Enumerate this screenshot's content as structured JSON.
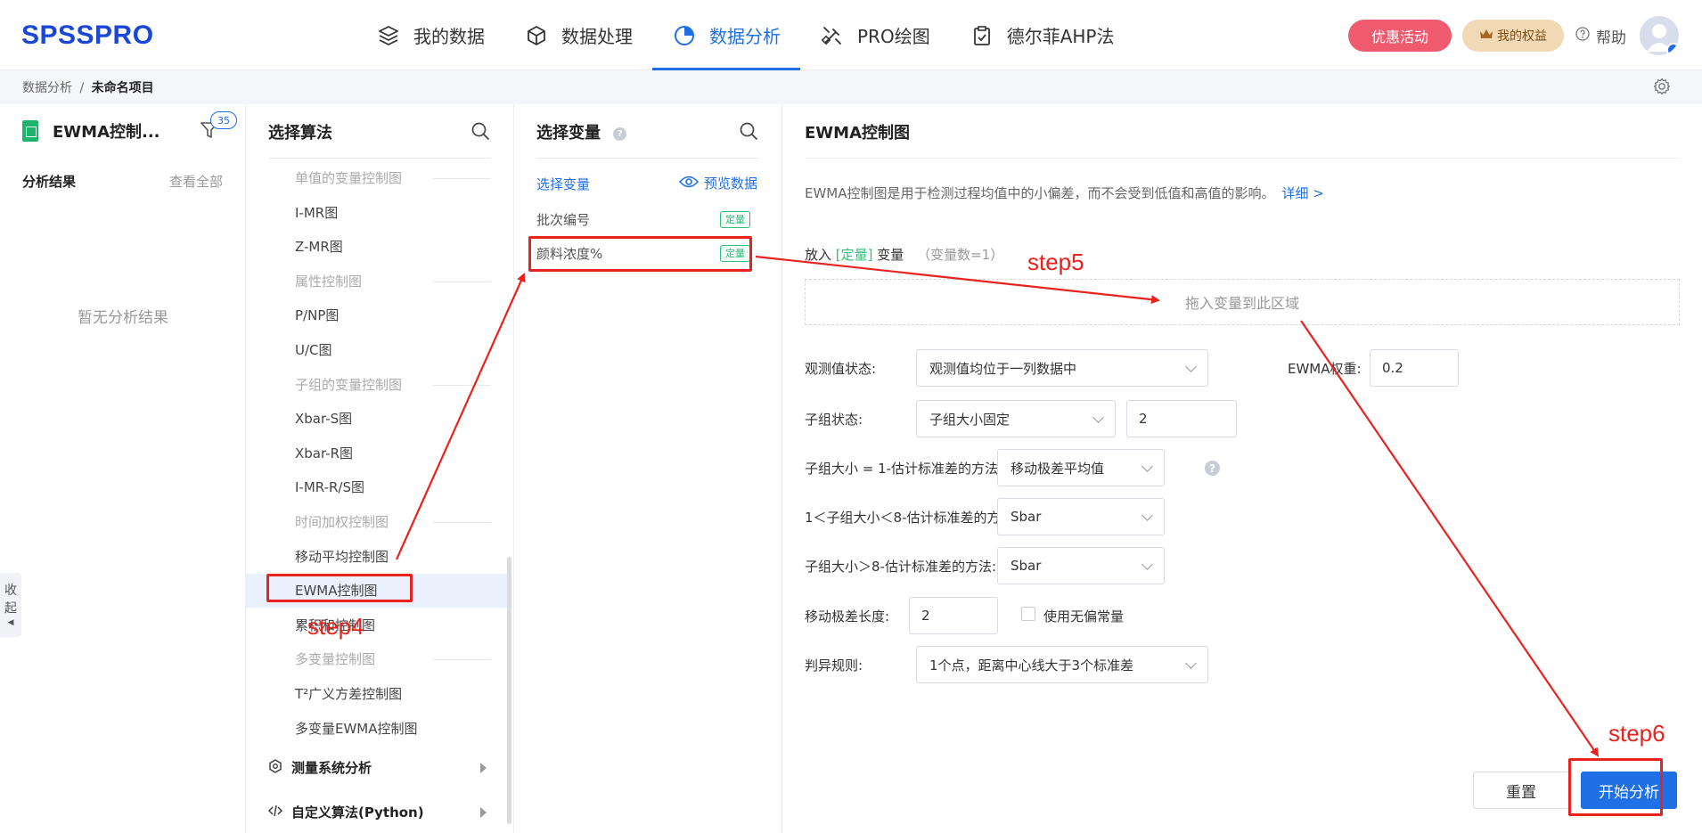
{
  "header": {
    "logo": "SPSSPRO",
    "nav": [
      {
        "label": "我的数据",
        "icon": "layers-icon"
      },
      {
        "label": "数据处理",
        "icon": "cube-icon"
      },
      {
        "label": "数据分析",
        "icon": "pie-chart-icon",
        "active": true
      },
      {
        "label": "PRO绘图",
        "icon": "brush-icon"
      },
      {
        "label": "德尔菲AHP法",
        "icon": "clipboard-icon"
      }
    ],
    "promo_label": "优惠活动",
    "rights_label": "我的权益",
    "help_label": "帮助"
  },
  "breadcrumb": {
    "root": "数据分析",
    "separator": "/",
    "current": "未命名项目"
  },
  "left_panel": {
    "title": "EWMA控制...",
    "filter_count": "35",
    "results_label": "分析结果",
    "view_all_label": "查看全部",
    "empty_text": "暂无分析结果",
    "collapse_label": [
      "收",
      "起"
    ]
  },
  "algo_panel": {
    "title": "选择算法",
    "entries": [
      {
        "type": "category",
        "label": "单值的变量控制图"
      },
      {
        "type": "item",
        "label": "I-MR图"
      },
      {
        "type": "item",
        "label": "Z-MR图"
      },
      {
        "type": "category",
        "label": "属性控制图"
      },
      {
        "type": "item",
        "label": "P/NP图"
      },
      {
        "type": "item",
        "label": "U/C图"
      },
      {
        "type": "category",
        "label": "子组的变量控制图"
      },
      {
        "type": "item",
        "label": "Xbar-S图"
      },
      {
        "type": "item",
        "label": "Xbar-R图"
      },
      {
        "type": "item",
        "label": "I-MR-R/S图"
      },
      {
        "type": "category",
        "label": "时间加权控制图"
      },
      {
        "type": "item",
        "label": "移动平均控制图"
      },
      {
        "type": "item",
        "label": "EWMA控制图",
        "selected": true
      },
      {
        "type": "item",
        "label": "累积和控制图"
      },
      {
        "type": "category",
        "label": "多变量控制图"
      },
      {
        "type": "item",
        "label": "T²广义方差控制图"
      },
      {
        "type": "item",
        "label": "多变量EWMA控制图"
      }
    ],
    "groups": [
      {
        "label": "测量系统分析",
        "icon": "hexagon-icon"
      },
      {
        "label": "自定义算法(Python)",
        "icon": "code-icon"
      }
    ]
  },
  "var_panel": {
    "title": "选择变量",
    "select_link": "选择变量",
    "preview_label": "预览数据",
    "variables": [
      {
        "name": "批次编号",
        "tag": "定量"
      },
      {
        "name": "颜料浓度%",
        "tag": "定量"
      }
    ]
  },
  "config_panel": {
    "title": "EWMA控制图",
    "description": "EWMA控制图是用于检测过程均值中的小偏差，而不会受到低值和高值的影响。",
    "detail_link": "详细 >",
    "put_prefix": "放入",
    "put_tag": "[定量]",
    "put_suffix": "变量",
    "var_count": "（变量数=1）",
    "dropzone_text": "拖入变量到此区域",
    "obs_state_label": "观测值状态:",
    "obs_state_value": "观测值均位于一列数据中",
    "ewma_weight_label": "EWMA权重:",
    "ewma_weight_value": "0.2",
    "subgroup_state_label": "子组状态:",
    "subgroup_state_value": "子组大小固定",
    "subgroup_size_value": "2",
    "method1_label": "子组大小 = 1-估计标准差的方法:",
    "method1_value": "移动极差平均值",
    "method2_label": "1＜子组大小＜8-估计标准差的方法:",
    "method2_value": "Sbar",
    "method3_label": "子组大小＞8-估计标准差的方法:",
    "method3_value": "Sbar",
    "mr_length_label": "移动极差长度:",
    "mr_length_value": "2",
    "unbiased_label": "使用无偏常量",
    "rule_label": "判异规则:",
    "rule_value": "1个点，距离中心线大于3个标准差",
    "reset_label": "重置",
    "start_label": "开始分析"
  },
  "annotations": {
    "step4": "step4",
    "step5": "step5",
    "step6": "step6"
  },
  "colors": {
    "brand": "#1a47d6",
    "primary": "#1f6fe5",
    "annotation": "#e8231f",
    "tag": "#2fbf7a",
    "promo": "#ef5a6f"
  }
}
